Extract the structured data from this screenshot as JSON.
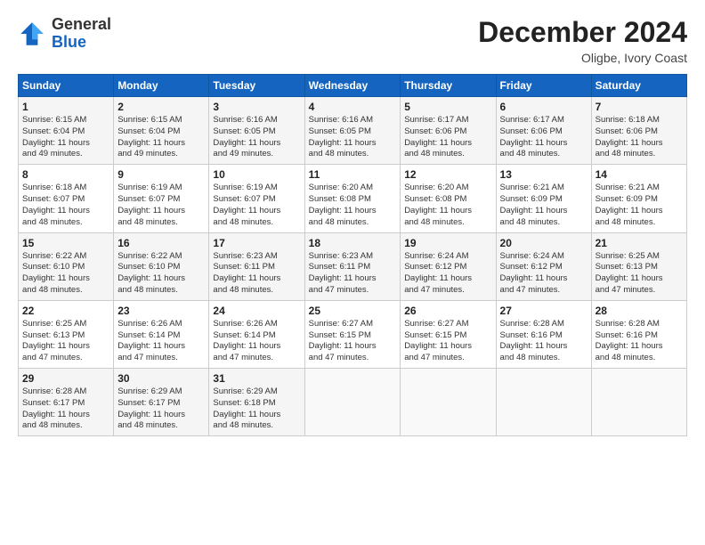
{
  "header": {
    "logo_general": "General",
    "logo_blue": "Blue",
    "month_title": "December 2024",
    "location": "Oligbe, Ivory Coast"
  },
  "calendar": {
    "days_of_week": [
      "Sunday",
      "Monday",
      "Tuesday",
      "Wednesday",
      "Thursday",
      "Friday",
      "Saturday"
    ],
    "weeks": [
      [
        {
          "day": "1",
          "info": "Sunrise: 6:15 AM\nSunset: 6:04 PM\nDaylight: 11 hours\nand 49 minutes."
        },
        {
          "day": "2",
          "info": "Sunrise: 6:15 AM\nSunset: 6:04 PM\nDaylight: 11 hours\nand 49 minutes."
        },
        {
          "day": "3",
          "info": "Sunrise: 6:16 AM\nSunset: 6:05 PM\nDaylight: 11 hours\nand 49 minutes."
        },
        {
          "day": "4",
          "info": "Sunrise: 6:16 AM\nSunset: 6:05 PM\nDaylight: 11 hours\nand 48 minutes."
        },
        {
          "day": "5",
          "info": "Sunrise: 6:17 AM\nSunset: 6:06 PM\nDaylight: 11 hours\nand 48 minutes."
        },
        {
          "day": "6",
          "info": "Sunrise: 6:17 AM\nSunset: 6:06 PM\nDaylight: 11 hours\nand 48 minutes."
        },
        {
          "day": "7",
          "info": "Sunrise: 6:18 AM\nSunset: 6:06 PM\nDaylight: 11 hours\nand 48 minutes."
        }
      ],
      [
        {
          "day": "8",
          "info": "Sunrise: 6:18 AM\nSunset: 6:07 PM\nDaylight: 11 hours\nand 48 minutes."
        },
        {
          "day": "9",
          "info": "Sunrise: 6:19 AM\nSunset: 6:07 PM\nDaylight: 11 hours\nand 48 minutes."
        },
        {
          "day": "10",
          "info": "Sunrise: 6:19 AM\nSunset: 6:07 PM\nDaylight: 11 hours\nand 48 minutes."
        },
        {
          "day": "11",
          "info": "Sunrise: 6:20 AM\nSunset: 6:08 PM\nDaylight: 11 hours\nand 48 minutes."
        },
        {
          "day": "12",
          "info": "Sunrise: 6:20 AM\nSunset: 6:08 PM\nDaylight: 11 hours\nand 48 minutes."
        },
        {
          "day": "13",
          "info": "Sunrise: 6:21 AM\nSunset: 6:09 PM\nDaylight: 11 hours\nand 48 minutes."
        },
        {
          "day": "14",
          "info": "Sunrise: 6:21 AM\nSunset: 6:09 PM\nDaylight: 11 hours\nand 48 minutes."
        }
      ],
      [
        {
          "day": "15",
          "info": "Sunrise: 6:22 AM\nSunset: 6:10 PM\nDaylight: 11 hours\nand 48 minutes."
        },
        {
          "day": "16",
          "info": "Sunrise: 6:22 AM\nSunset: 6:10 PM\nDaylight: 11 hours\nand 48 minutes."
        },
        {
          "day": "17",
          "info": "Sunrise: 6:23 AM\nSunset: 6:11 PM\nDaylight: 11 hours\nand 48 minutes."
        },
        {
          "day": "18",
          "info": "Sunrise: 6:23 AM\nSunset: 6:11 PM\nDaylight: 11 hours\nand 47 minutes."
        },
        {
          "day": "19",
          "info": "Sunrise: 6:24 AM\nSunset: 6:12 PM\nDaylight: 11 hours\nand 47 minutes."
        },
        {
          "day": "20",
          "info": "Sunrise: 6:24 AM\nSunset: 6:12 PM\nDaylight: 11 hours\nand 47 minutes."
        },
        {
          "day": "21",
          "info": "Sunrise: 6:25 AM\nSunset: 6:13 PM\nDaylight: 11 hours\nand 47 minutes."
        }
      ],
      [
        {
          "day": "22",
          "info": "Sunrise: 6:25 AM\nSunset: 6:13 PM\nDaylight: 11 hours\nand 47 minutes."
        },
        {
          "day": "23",
          "info": "Sunrise: 6:26 AM\nSunset: 6:14 PM\nDaylight: 11 hours\nand 47 minutes."
        },
        {
          "day": "24",
          "info": "Sunrise: 6:26 AM\nSunset: 6:14 PM\nDaylight: 11 hours\nand 47 minutes."
        },
        {
          "day": "25",
          "info": "Sunrise: 6:27 AM\nSunset: 6:15 PM\nDaylight: 11 hours\nand 47 minutes."
        },
        {
          "day": "26",
          "info": "Sunrise: 6:27 AM\nSunset: 6:15 PM\nDaylight: 11 hours\nand 47 minutes."
        },
        {
          "day": "27",
          "info": "Sunrise: 6:28 AM\nSunset: 6:16 PM\nDaylight: 11 hours\nand 48 minutes."
        },
        {
          "day": "28",
          "info": "Sunrise: 6:28 AM\nSunset: 6:16 PM\nDaylight: 11 hours\nand 48 minutes."
        }
      ],
      [
        {
          "day": "29",
          "info": "Sunrise: 6:28 AM\nSunset: 6:17 PM\nDaylight: 11 hours\nand 48 minutes."
        },
        {
          "day": "30",
          "info": "Sunrise: 6:29 AM\nSunset: 6:17 PM\nDaylight: 11 hours\nand 48 minutes."
        },
        {
          "day": "31",
          "info": "Sunrise: 6:29 AM\nSunset: 6:18 PM\nDaylight: 11 hours\nand 48 minutes."
        },
        {
          "day": "",
          "info": ""
        },
        {
          "day": "",
          "info": ""
        },
        {
          "day": "",
          "info": ""
        },
        {
          "day": "",
          "info": ""
        }
      ]
    ]
  }
}
